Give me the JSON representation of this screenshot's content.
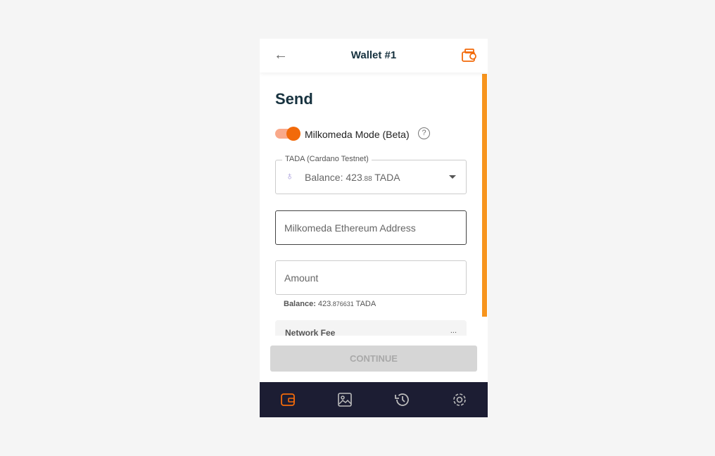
{
  "header": {
    "title": "Wallet #1",
    "back_icon": "arrow-left-icon",
    "wallet_icon": "wallets-icon"
  },
  "send": {
    "title": "Send",
    "toggle_label": "Milkomeda Mode (Beta)",
    "toggle_on": true,
    "help": "?",
    "asset": {
      "legend": "TADA  (Cardano Testnet)",
      "balance_label": "Balance: 423",
      "balance_decimals": ".88",
      "unit": " TADA"
    },
    "address_placeholder": "Milkomeda Ethereum Address",
    "amount_placeholder": "Amount",
    "balance": {
      "label": "Balance:",
      "int": "423",
      "dec": ".876631",
      "unit": " TADA"
    },
    "fee": {
      "label": "Network Fee",
      "value": "..."
    },
    "continue": "CONTINUE"
  },
  "nav": [
    "wallet-icon",
    "gallery-icon",
    "history-icon",
    "settings-icon"
  ],
  "colors": {
    "accent": "#f26a0a",
    "nav_bg": "#1c1d33",
    "scrollbar": "#f7941d"
  }
}
